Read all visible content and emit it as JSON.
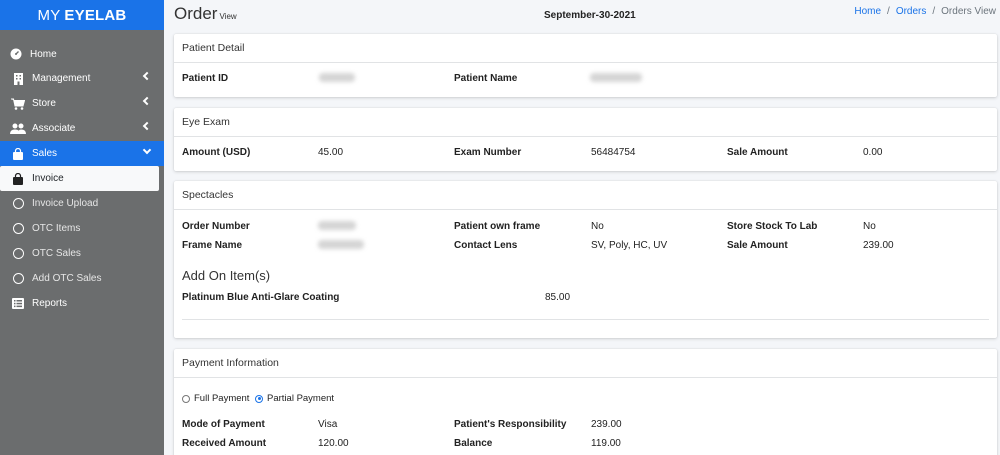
{
  "brand": {
    "prefix": "MY",
    "name": "EYELAB"
  },
  "sidebar": {
    "home": "Home",
    "management": "Management",
    "store": "Store",
    "associate": "Associate",
    "sales": "Sales",
    "invoice": "Invoice",
    "invoice_upload": "Invoice Upload",
    "otc_items": "OTC Items",
    "otc_sales": "OTC Sales",
    "add_otc_sales": "Add OTC Sales",
    "reports": "Reports"
  },
  "header": {
    "title": "Order",
    "subtitle": "View",
    "date": "September-30-2021",
    "breadcrumb": [
      "Home",
      "Orders",
      "Orders View"
    ],
    "breadcrumb_sep": "/"
  },
  "patient_detail": {
    "title": "Patient Detail",
    "patient_id_label": "Patient ID",
    "patient_name_label": "Patient Name"
  },
  "eye_exam": {
    "title": "Eye Exam",
    "amount_label": "Amount (USD)",
    "amount_value": "45.00",
    "exam_number_label": "Exam Number",
    "exam_number_value": "56484754",
    "sale_amount_label": "Sale Amount",
    "sale_amount_value": "0.00"
  },
  "spectacles": {
    "title": "Spectacles",
    "order_number_label": "Order Number",
    "patient_own_frame_label": "Patient own frame",
    "patient_own_frame_value": "No",
    "store_stock_label": "Store Stock To Lab",
    "store_stock_value": "No",
    "frame_name_label": "Frame Name",
    "contact_lens_label": "Contact Lens",
    "contact_lens_value": "SV, Poly, HC, UV",
    "sale_amount_label": "Sale Amount",
    "sale_amount_value": "239.00",
    "addon_title": "Add On Item(s)",
    "addon_item_label": "Platinum Blue Anti-Glare Coating",
    "addon_item_value": "85.00"
  },
  "payment": {
    "title": "Payment Information",
    "full_payment": "Full Payment",
    "partial_payment": "Partial Payment",
    "mode_label": "Mode of Payment",
    "mode_value": "Visa",
    "responsibility_label": "Patient's Responsibility",
    "responsibility_value": "239.00",
    "received_label": "Received Amount",
    "received_value": "120.00",
    "balance_label": "Balance",
    "balance_value": "119.00"
  },
  "colors": {
    "accent": "#1a73e8",
    "sidebar_bg": "#6b6d6e"
  }
}
